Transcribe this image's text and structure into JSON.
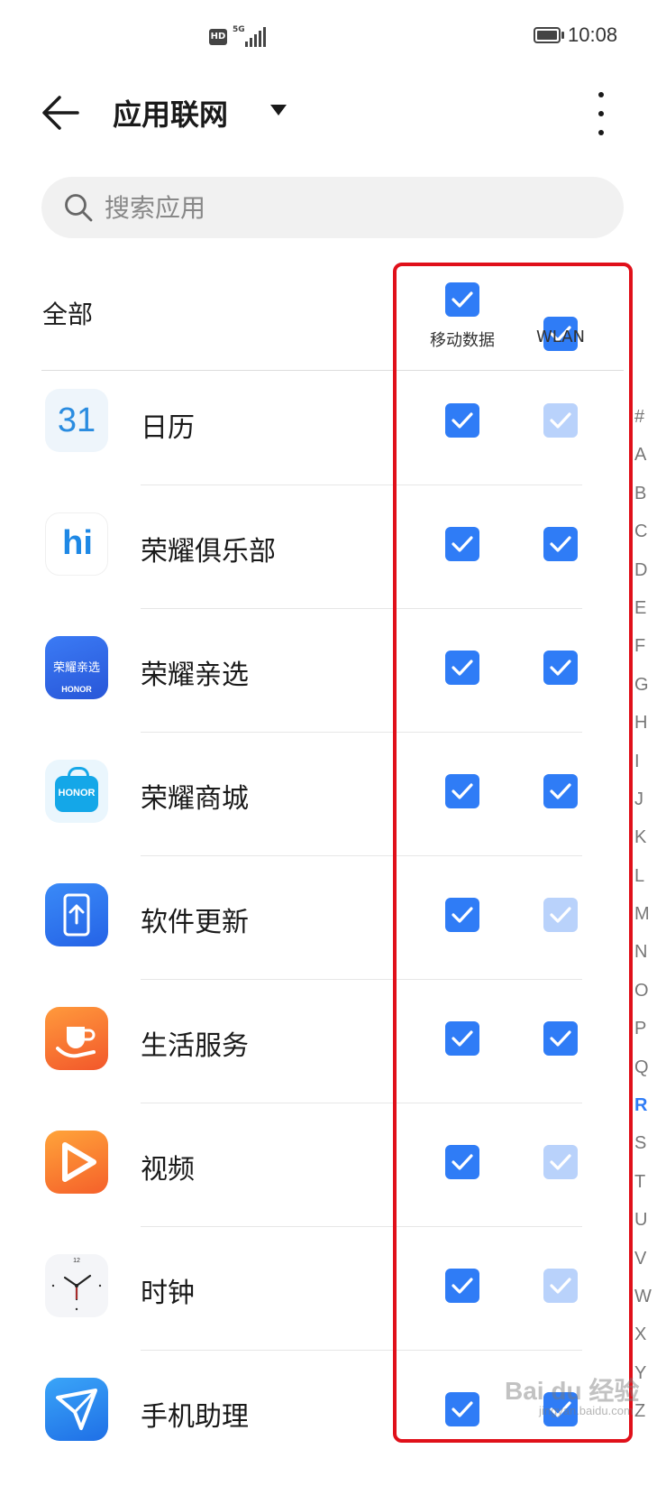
{
  "status_bar": {
    "hd_badge": "HD",
    "network": "5G",
    "time": "10:08"
  },
  "app_bar": {
    "title": "应用联网"
  },
  "search": {
    "placeholder": "搜索应用"
  },
  "header_row": {
    "all_label": "全部",
    "mobile_data_label": "移动数据",
    "wlan_label": "WLAN"
  },
  "colors": {
    "accent": "#2f7cf6",
    "checkbox_disabled": "#b9d2fb",
    "highlight_border": "#e0101a"
  },
  "apps": [
    {
      "name": "日历",
      "icon": "calendar-icon",
      "icon_text": "31",
      "mobile_data": true,
      "wlan": true,
      "wlan_disabled": true
    },
    {
      "name": "荣耀俱乐部",
      "icon": "honor-club-icon",
      "icon_text": "hi",
      "mobile_data": true,
      "wlan": true,
      "wlan_disabled": false
    },
    {
      "name": "荣耀亲选",
      "icon": "honor-choice-icon",
      "icon_text": "荣耀亲选",
      "icon_subtext": "HONOR",
      "mobile_data": true,
      "wlan": true,
      "wlan_disabled": false
    },
    {
      "name": "荣耀商城",
      "icon": "honor-mall-icon",
      "icon_text": "HONOR",
      "mobile_data": true,
      "wlan": true,
      "wlan_disabled": false
    },
    {
      "name": "软件更新",
      "icon": "software-update-icon",
      "mobile_data": true,
      "wlan": true,
      "wlan_disabled": true
    },
    {
      "name": "生活服务",
      "icon": "life-service-icon",
      "mobile_data": true,
      "wlan": true,
      "wlan_disabled": false
    },
    {
      "name": "视频",
      "icon": "video-icon",
      "mobile_data": true,
      "wlan": true,
      "wlan_disabled": true
    },
    {
      "name": "时钟",
      "icon": "clock-icon",
      "icon_text": "12",
      "mobile_data": true,
      "wlan": true,
      "wlan_disabled": true
    },
    {
      "name": "手机助理",
      "icon": "phone-assistant-icon",
      "mobile_data": true,
      "wlan": true,
      "wlan_disabled": false
    }
  ],
  "alphabet_index": [
    "#",
    "A",
    "B",
    "C",
    "D",
    "E",
    "F",
    "G",
    "H",
    "I",
    "J",
    "K",
    "L",
    "M",
    "N",
    "O",
    "P",
    "Q",
    "R",
    "S",
    "T",
    "U",
    "V",
    "W",
    "X",
    "Y",
    "Z"
  ],
  "alphabet_active": "R",
  "watermark": {
    "main": "Bai du 经验",
    "sub": "jingyan.baidu.com"
  }
}
